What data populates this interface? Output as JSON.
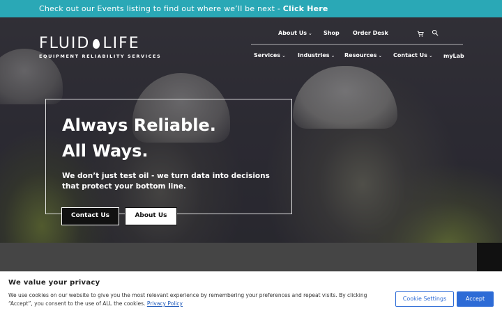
{
  "announcement": {
    "text": "Check out our Events listing to find out where we’ll be next - ",
    "link": "Click Here"
  },
  "logo": {
    "word_left": "FLUID",
    "word_right": "LIFE",
    "tagline": "EQUIPMENT RELIABILITY SERVICES"
  },
  "top_nav": {
    "about": "About Us",
    "shop": "Shop",
    "order_desk": "Order Desk"
  },
  "main_nav": {
    "services": "Services",
    "industries": "Industries",
    "resources": "Resources",
    "contact": "Contact Us",
    "mylab": "myLab"
  },
  "hero": {
    "headline_line1": "Always Reliable.",
    "headline_line2": "All Ways.",
    "subline": "We don’t just test oil - we turn data into decisions that protect your bottom line.",
    "btn_contact": "Contact Us",
    "btn_about": "About Us"
  },
  "cookie": {
    "title": "We value your privacy",
    "text": "We use cookies on our website to give you the most relevant experience by remembering your preferences and repeat visits. By clicking “Accept”, you consent to the use of ALL the cookies. ",
    "policy_link": "Privacy Policy",
    "settings_label": "Cookie Settings",
    "accept_label": "Accept"
  },
  "colors": {
    "announcement_bg": "#2aa8b6",
    "accept_bg": "#2d6bd6"
  },
  "icons": [
    "cart-icon",
    "search-icon",
    "chevron-down-icon",
    "water-drop-icon"
  ]
}
